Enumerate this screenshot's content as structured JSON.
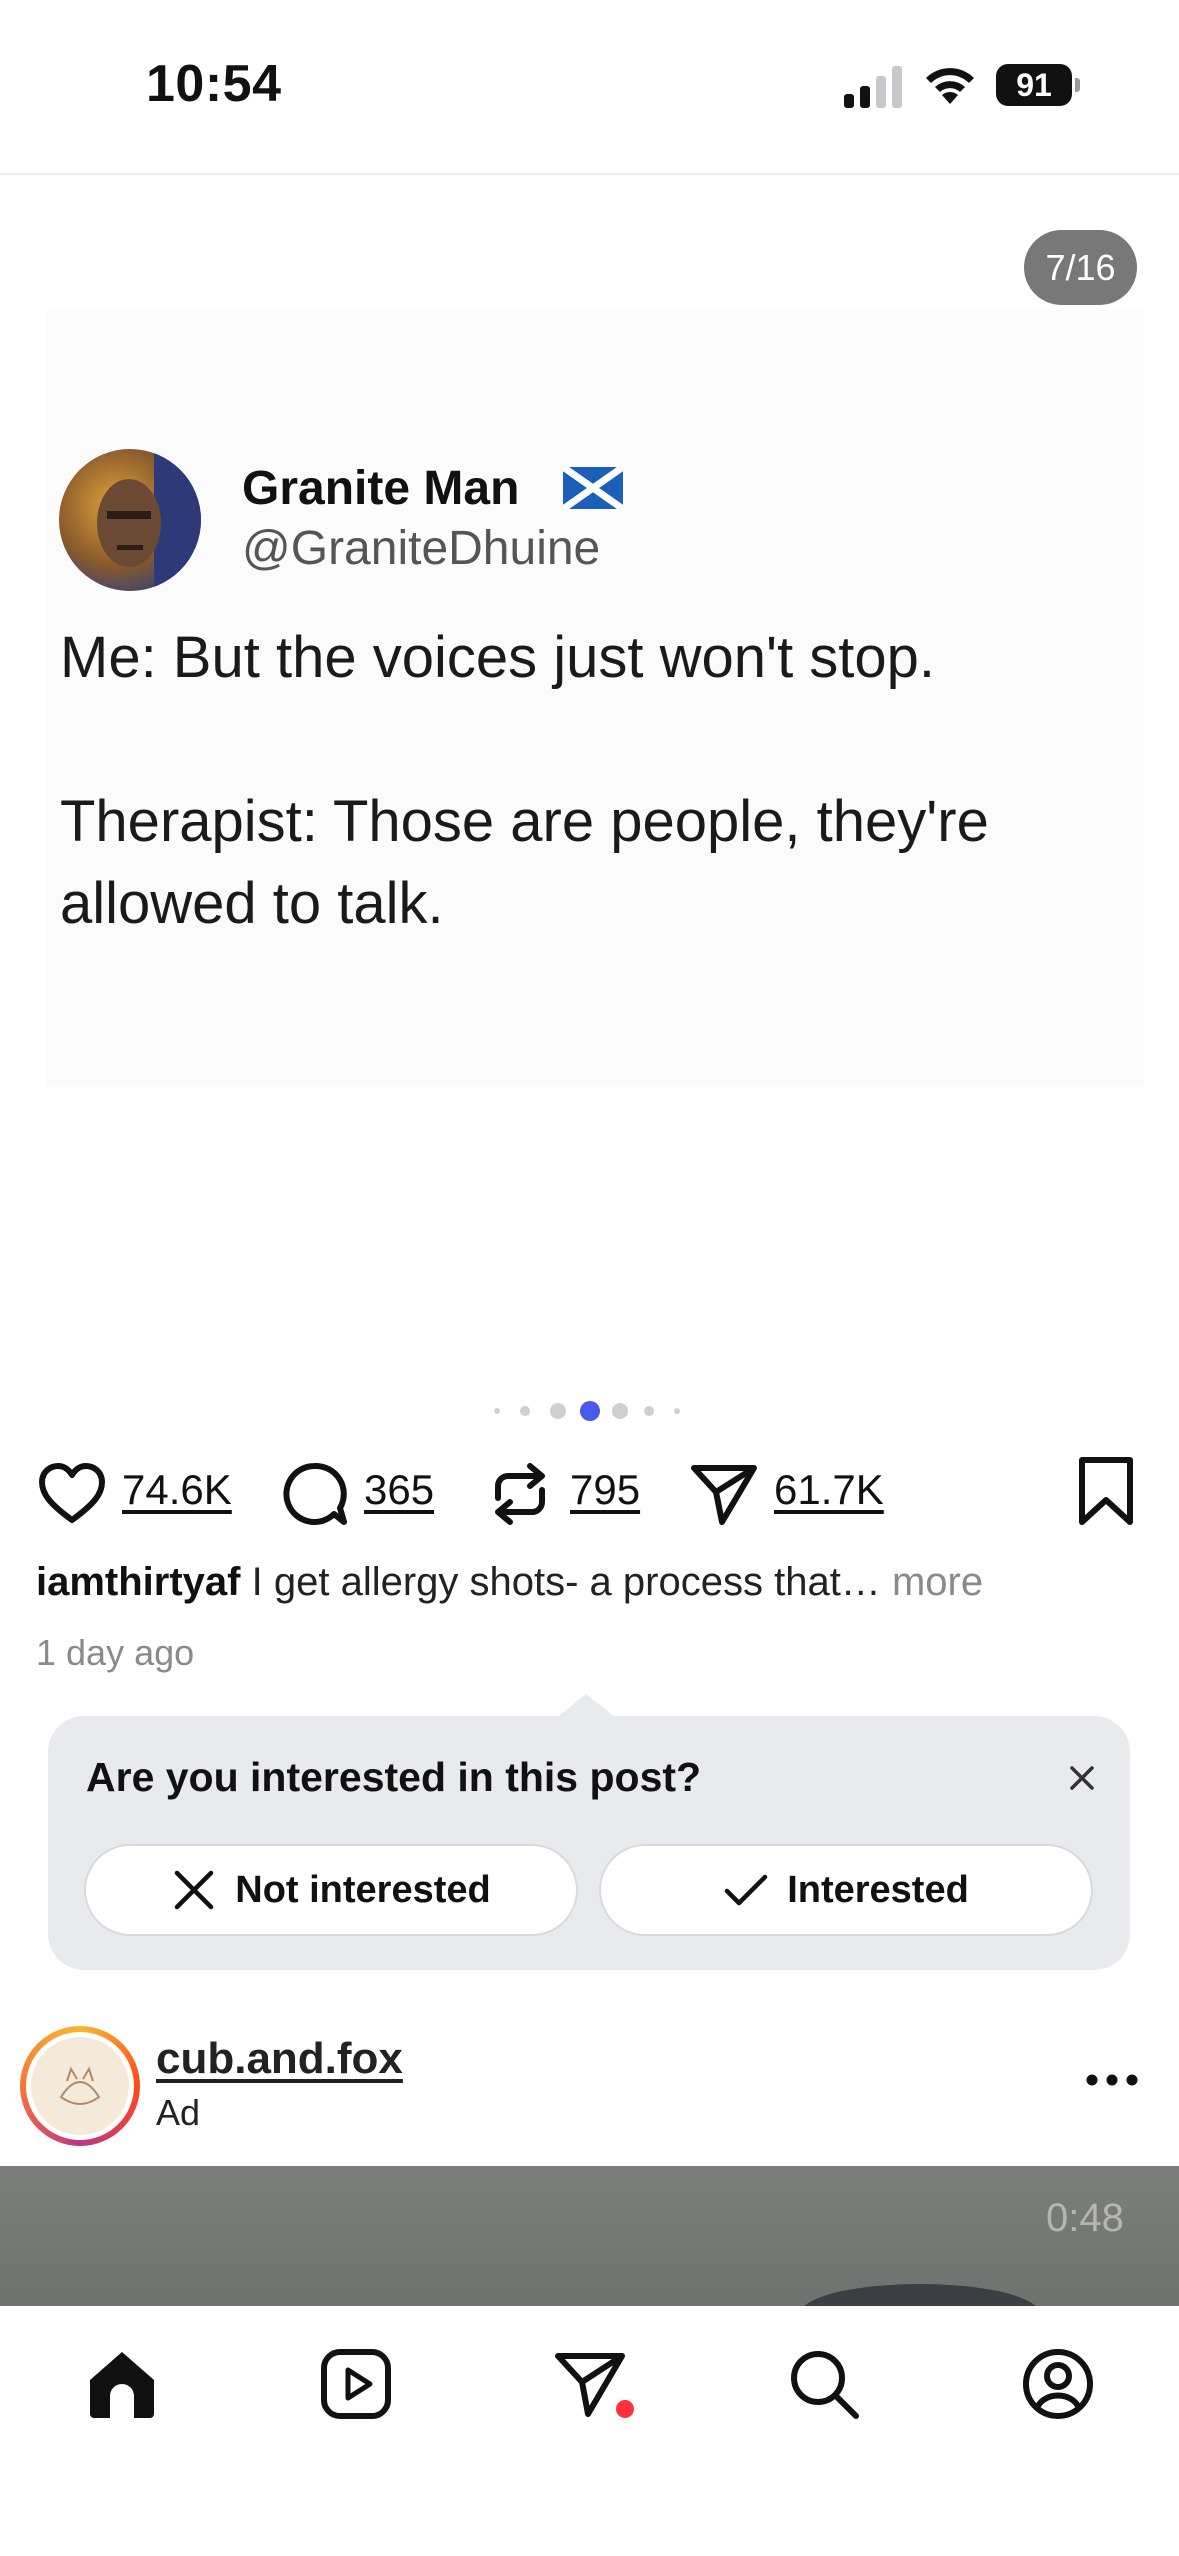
{
  "status_bar": {
    "time": "10:54",
    "battery": "91"
  },
  "post": {
    "counter": "7/16",
    "tweet": {
      "name": "Granite Man",
      "handle": "@GraniteDhuine",
      "text": "Me: But the voices just won't stop.\n\nTherapist: Those are people, they're allowed to talk."
    },
    "carousel_active_index": 3,
    "actions": {
      "likes": "74.6K",
      "comments": "365",
      "reposts": "795",
      "shares": "61.7K"
    },
    "caption": {
      "username": "iamthirtyaf",
      "text": "I get allergy shots- a process that…",
      "more_label": "more"
    },
    "time_ago": "1 day ago"
  },
  "interest_prompt": {
    "title": "Are you interested in this post?",
    "not_interested_label": "Not interested",
    "interested_label": "Interested"
  },
  "ad": {
    "username": "cub.and.fox",
    "label": "Ad",
    "video_time": "0:48"
  },
  "colors": {
    "accent_dot": "#4a5ae8",
    "notification": "#ff3040"
  }
}
